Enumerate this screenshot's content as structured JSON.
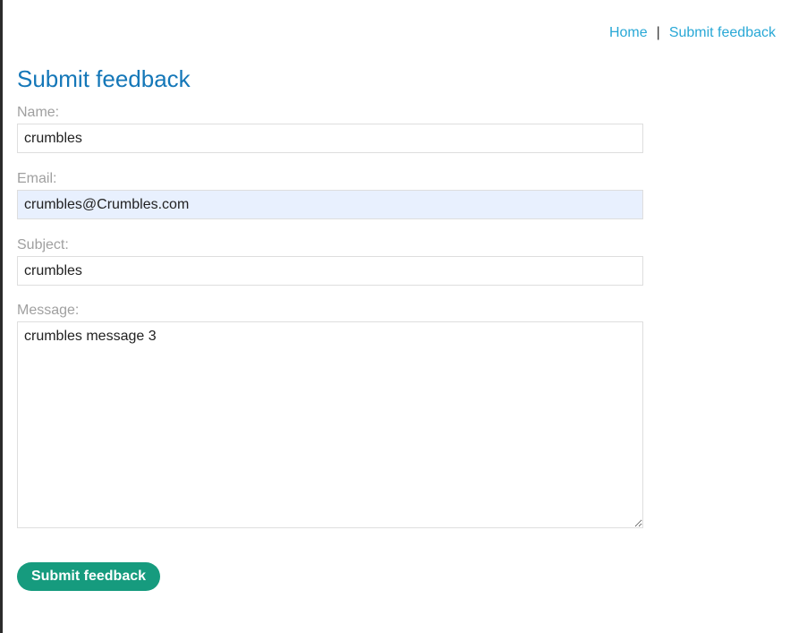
{
  "nav": {
    "home_label": "Home",
    "separator": "|",
    "submit_feedback_label": "Submit feedback",
    "link_color": "#29a8d6"
  },
  "page": {
    "title": "Submit feedback",
    "title_color": "#1477b8"
  },
  "form": {
    "name": {
      "label": "Name:",
      "value": "crumbles"
    },
    "email": {
      "label": "Email:",
      "value": "crumbles@Crumbles.com",
      "autofill_background": "#e8f0fe"
    },
    "subject": {
      "label": "Subject:",
      "value": "crumbles"
    },
    "message": {
      "label": "Message:",
      "value": "crumbles message 3"
    },
    "submit_label": "Submit feedback",
    "submit_color": "#169b7e"
  }
}
